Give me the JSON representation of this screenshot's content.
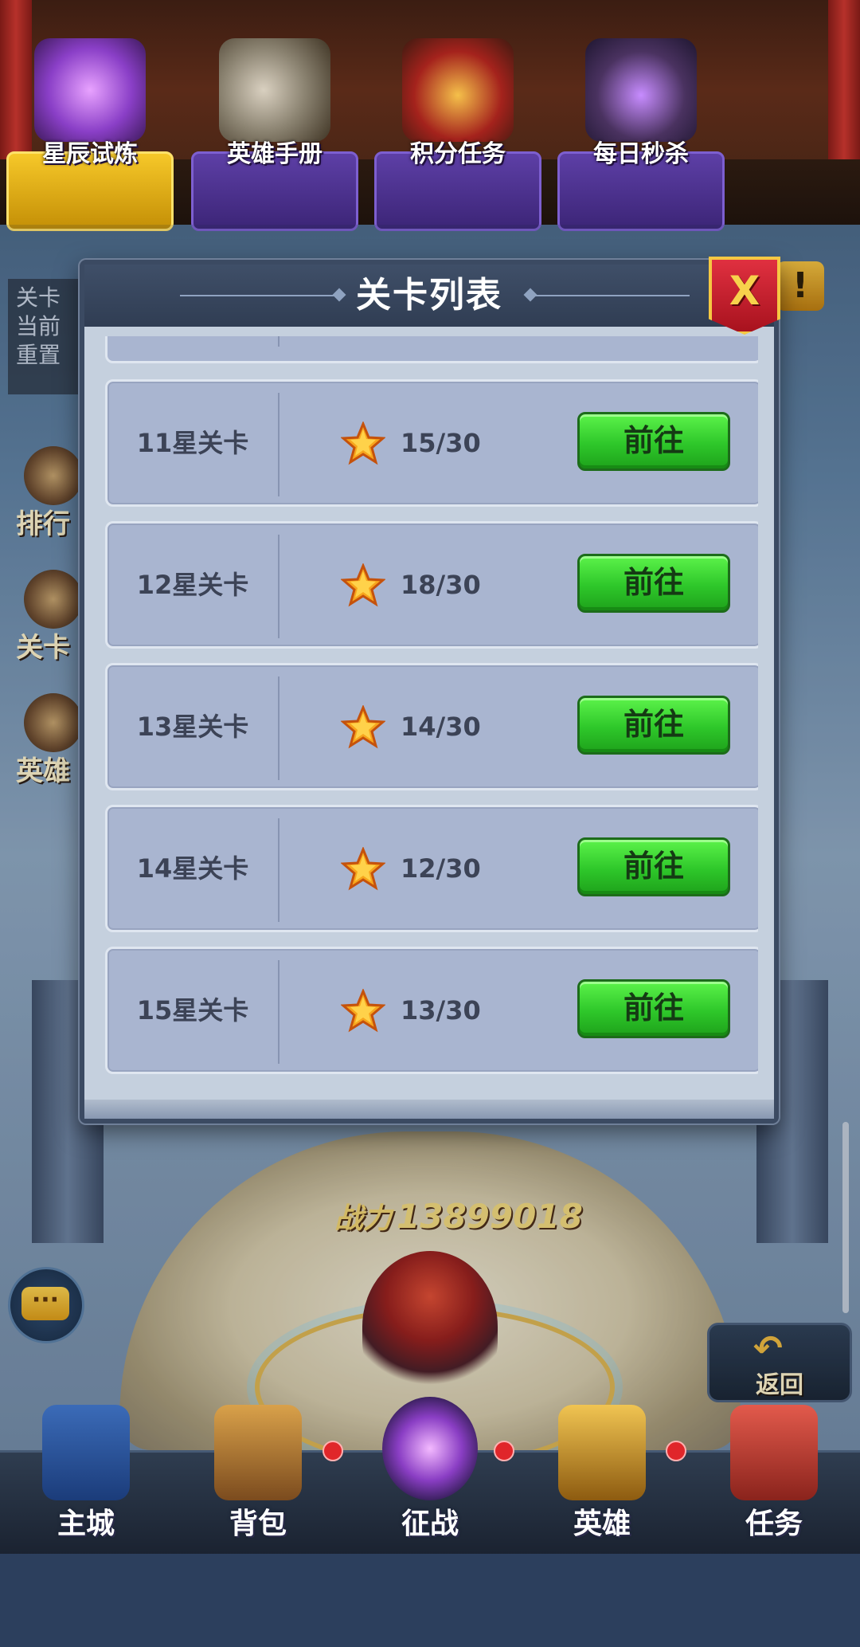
{
  "events": [
    {
      "label": "星辰试炼",
      "icon": "star-trial-icon",
      "active": true
    },
    {
      "label": "英雄手册",
      "icon": "hero-handbook-icon",
      "active": false
    },
    {
      "label": "积分任务",
      "icon": "points-task-icon",
      "active": false
    },
    {
      "label": "每日秒杀",
      "icon": "daily-flash-sale-icon",
      "active": false
    }
  ],
  "side_info": [
    "关卡",
    "当前",
    "重置"
  ],
  "side_buttons": [
    "排行",
    "关卡",
    "英雄"
  ],
  "alert_icon": "!",
  "power": {
    "label": "战力",
    "value": "13899018"
  },
  "chat_icon": "···",
  "back": {
    "arrow": "↶",
    "label": "返回"
  },
  "modal": {
    "title": "关卡列表",
    "close_label": "X",
    "rows": [
      {
        "name": "11星关卡",
        "count": "15/30",
        "button": "前往"
      },
      {
        "name": "12星关卡",
        "count": "18/30",
        "button": "前往"
      },
      {
        "name": "13星关卡",
        "count": "14/30",
        "button": "前往"
      },
      {
        "name": "14星关卡",
        "count": "12/30",
        "button": "前往"
      },
      {
        "name": "15星关卡",
        "count": "13/30",
        "button": "前往"
      }
    ]
  },
  "bottom_nav": [
    {
      "label": "主城",
      "icon": "main-city-icon"
    },
    {
      "label": "背包",
      "icon": "backpack-icon"
    },
    {
      "label": "征战",
      "icon": "battle-icon"
    },
    {
      "label": "英雄",
      "icon": "hero-helmet-icon"
    },
    {
      "label": "任务",
      "icon": "quest-scroll-icon"
    }
  ],
  "colors": {
    "go_button": "#2ec72a",
    "row_bg": "#a9b5d0",
    "close_button": "#e03040",
    "star": "#f7a51c"
  }
}
